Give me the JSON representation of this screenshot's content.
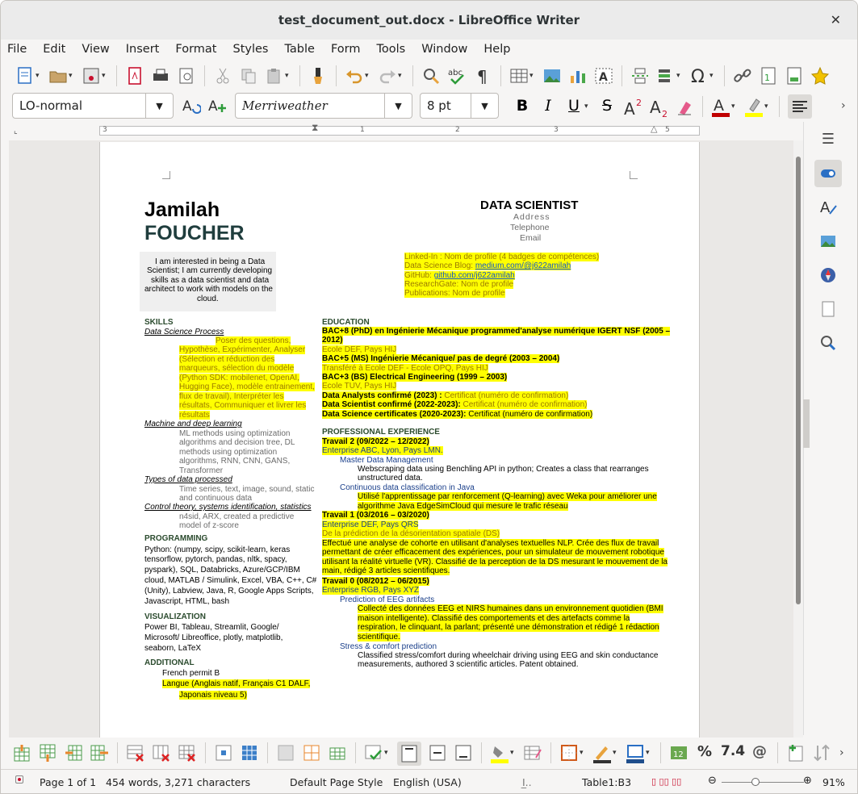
{
  "window": {
    "title": "test_document_out.docx - LibreOffice Writer",
    "close": "✕"
  },
  "menu": [
    "File",
    "Edit",
    "View",
    "Insert",
    "Format",
    "Styles",
    "Table",
    "Form",
    "Tools",
    "Window",
    "Help"
  ],
  "format_bar": {
    "para_style": "LO-normal",
    "font_name": "Merriweather",
    "font_size": "8 pt"
  },
  "ruler": {
    "labels": [
      "3",
      "1",
      "1",
      "2",
      "3",
      "4",
      "5"
    ]
  },
  "doc": {
    "first_name": "Jamilah",
    "last_name": "FOUCHER",
    "job_title": "DATA SCIENTIST",
    "address": "Address",
    "telephone": "Telephone",
    "email": "Email",
    "summary": [
      "I am interested in being a Data",
      "Scientist; I am currently developing",
      "skills as a data scientist and data",
      "architect to work with models on the",
      "cloud."
    ],
    "links": {
      "linkedin": "Linked-In : Nom de profile (4 badges de compétences)",
      "blog_label": "Data Science Blog: ",
      "blog_url": "medium.com/@j622amilah",
      "github_label": "GitHub: ",
      "github_url": "github.com/j622amilah",
      "researchgate": "ResearchGate: Nom de profile",
      "publications": "Publications: Nom de profile"
    },
    "skills": {
      "heading": "SKILLS",
      "ds_process": "Data Science Process",
      "ds_lines": [
        "Poser des questions,",
        "Hypothèse, Expérimenter, Analyser",
        "(Sélection et réduction des",
        "marqueurs, sélection du modèle",
        "(Python SDK: mobilenet, OpenAI,",
        "Hugging Face), modèle entrainement,",
        "flux de travail), Interpréter les",
        "résultats, Communiquer et livrer les",
        "résultats"
      ],
      "ml": "Machine and deep learning",
      "ml_lines": [
        "ML methods using optimization",
        "algorithms and decision tree, DL",
        "methods using optimization",
        "algorithms, RNN, CNN, GANS,",
        "Transformer"
      ],
      "types": "Types of data processed",
      "types_lines": [
        "Time series, text, image, sound, static",
        "and continuous data"
      ],
      "control": "Control theory, systems identification, statistics",
      "control_lines": [
        "n4sid, ARX, created a predictive",
        "model of z-score"
      ]
    },
    "programming": {
      "heading": "PROGRAMMING",
      "lines": [
        "Python: (numpy, scipy, scikit-learn, keras",
        "tensorflow, pytorch, pandas, nltk, spacy,",
        "pyspark), SQL, Databricks, Azure/GCP/IBM",
        "cloud,  MATLAB / Simulink, Excel, VBA, C++, C#",
        "(Unity),  Labview, Java, R, Google Apps Scripts,",
        "Javascript, HTML, bash"
      ]
    },
    "visualization": {
      "heading": "VISUALIZATION",
      "lines": [
        "Power BI, Tableau, Streamlit, Google/",
        "Microsoft/ Libreoffice, plotly, matplotlib,",
        "seaborn, LaTeX"
      ]
    },
    "additional": {
      "heading": "ADDITIONAL",
      "permit": "French permit B",
      "langue_lines": [
        "Langue (Anglais natif, Français C1 DALF,",
        "Japonais niveau 5)"
      ]
    },
    "education": {
      "heading": "EDUCATION",
      "phd_lines": [
        "BAC+8 (PhD) en Ingénierie Mécanique programmed'analyse numérique IGERT NSF  (2005 –",
        "2012)"
      ],
      "phd_school": "Ecole DEF, Pays HIJ",
      "ms": "BAC+5 (MS) Ingénierie Mécanique/ pas de degré (2003 – 2004)",
      "ms_school": "Transféré à Ecole DEF - Ecole OPQ, Pays HIJ",
      "bs": "BAC+3 (BS) Electrical Engineering (1999 – 2003)",
      "bs_school": "Ecole TUV, Pays HIJ",
      "c1a": "Data Analysts confirmé (2023) : ",
      "c1b": "Certificat (numéro de confirmation)",
      "c2a": "Data Scientist confirmé (2022-2023): ",
      "c2b": "Certificat (numéro de confirmation)",
      "c3a": "Data Science certificates (2020-2023): ",
      "c3b": "Certificat (numéro de confirmation)"
    },
    "experience": {
      "heading": "PROFESSIONAL EXPERIENCE",
      "j2": "Travail 2 (09/2022 – 12/2022)",
      "j2_ent": "Enterprise ABC, Lyon, Pays LMN.",
      "j2_r1": "Master Data Management",
      "j2_r1_lines": [
        "Webscraping data using Benchling API in python; Creates a class that rearranges",
        "unstructured data."
      ],
      "j2_r2": "Continuous data classification in Java",
      "j2_r2_lines": [
        "Utilisé l'apprentissage par renforcement (Q-learning) avec Weka pour améliorer une",
        "algorithme Java EdgeSimCloud qui mesure le trafic réseau"
      ],
      "j1": "Travail 1 (03/2016 – 03/2020)",
      "j1_ent": "Enterprise DEF, Pays QRS",
      "j1_r1": "De la prédiction de la désorientation spatiale (DS)",
      "j1_lines": [
        "Effectué une analyse de cohorte en utilisant d'analyses textuelles NLP. Crée des flux de travail",
        "permettant de créer efficacement des expériences, pour un simulateur de mouvement robotique",
        "utilisant la réalité virtuelle (VR). Classifié de la perception de la DS mesurant le mouvement de la",
        "main, rédigé 3 articles scientifiques."
      ],
      "j0": "Travail 0 (08/2012 – 06/2015)",
      "j0_ent": "Enterprise RGB, Pays XYZ",
      "j0_r1": "Prediction of EEG artifacts",
      "j0_r1_lines": [
        "Collecté des données EEG et NIRS humaines dans un environnement quotidien (BMI",
        "maison intelligente). Classifié des comportements et des artefacts comme la",
        "respiration, le clinquant, la parlant; présenté une démonstration et rédigé 1 rédaction",
        "scientifique."
      ],
      "j0_r2": "Stress & comfort prediction",
      "j0_r2_lines": [
        "Classified stress/comfort during wheelchair driving using EEG and skin conductance",
        "measurements, authored 3 scientific articles. Patent obtained."
      ]
    }
  },
  "table_bar": {
    "percent": "%",
    "number": "7.4",
    "currency": "@"
  },
  "status": {
    "page": "Page 1 of 1",
    "words": "454 words, 3,271 characters",
    "page_style": "Default Page Style",
    "language": "English (USA)",
    "cell": "Table1:B3",
    "zoom": "91%"
  },
  "colors": {
    "highlight": "#ffff00",
    "heading_green": "#2b4b2e",
    "link_blue": "#1155cc",
    "accent_red": "#c00000"
  }
}
